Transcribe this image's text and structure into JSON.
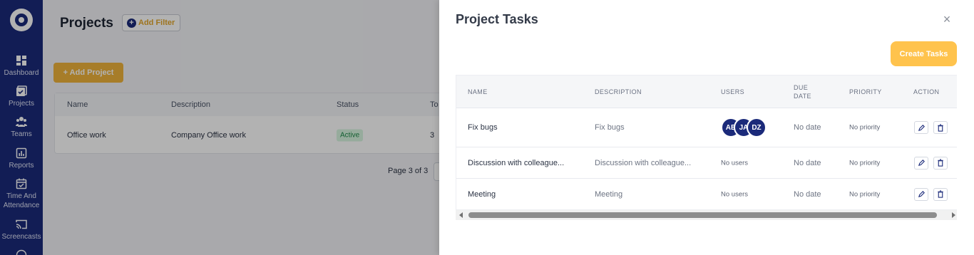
{
  "sidebar": {
    "items": [
      {
        "label": "Dashboard",
        "icon": "dashboard-icon"
      },
      {
        "label": "Projects",
        "icon": "projects-icon"
      },
      {
        "label": "Teams",
        "icon": "teams-icon"
      },
      {
        "label": "Reports",
        "icon": "reports-icon"
      },
      {
        "label": "Time And Attendance",
        "icon": "calendar-check-icon"
      },
      {
        "label": "Screencasts",
        "icon": "screencast-icon"
      }
    ]
  },
  "main": {
    "title": "Projects",
    "add_filter_label": "Add Filter",
    "add_project_label": "+ Add Project",
    "table": {
      "columns": [
        "Name",
        "Description",
        "Status",
        "To"
      ],
      "rows": [
        {
          "name": "Office work",
          "description": "Company Office work",
          "status": "Active",
          "tasks": "3"
        }
      ]
    },
    "pagination": "Page 3 of 3"
  },
  "drawer": {
    "title": "Project Tasks",
    "close_glyph": "×",
    "create_label": "Create Tasks",
    "columns": {
      "name": "NAME",
      "description": "DESCRIPTION",
      "users": "USERS",
      "due_date_1": "DUE",
      "due_date_2": "DATE",
      "priority": "PRIORITY",
      "action": "ACTION"
    },
    "tasks": [
      {
        "name": "Fix bugs",
        "description": "Fix bugs",
        "users": [
          "AB",
          "JA",
          "DZ"
        ],
        "due": "No date",
        "priority": "No priority"
      },
      {
        "name": "Discussion with colleague...",
        "description": "Discussion with colleague...",
        "users_text": "No users",
        "due": "No date",
        "priority": "No priority"
      },
      {
        "name": "Meeting",
        "description": "Meeting",
        "users_text": "No users",
        "due": "No date",
        "priority": "No priority"
      }
    ]
  },
  "colors": {
    "sidebar": "#1b2a7a",
    "accent": "#ffc34d",
    "avatar": "#1b2a7a"
  }
}
